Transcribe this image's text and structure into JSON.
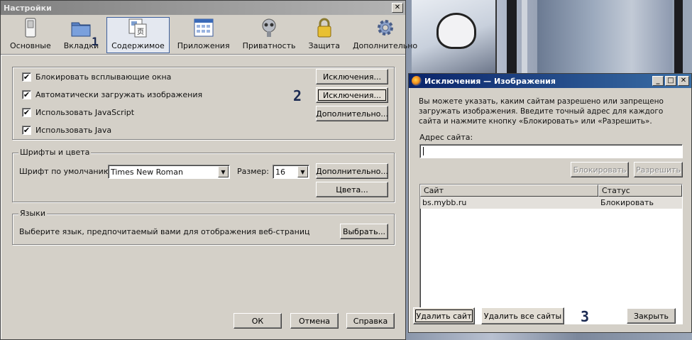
{
  "settings": {
    "title": "Настройки",
    "close": "✕",
    "tabs": [
      {
        "label": "Основные",
        "icon": "switch-icon"
      },
      {
        "label": "Вкладки",
        "icon": "folder-tabs-icon"
      },
      {
        "label": "Содержимое",
        "icon": "content-icon"
      },
      {
        "label": "Приложения",
        "icon": "applications-icon"
      },
      {
        "label": "Приватность",
        "icon": "privacy-mask-icon"
      },
      {
        "label": "Защита",
        "icon": "lock-icon"
      },
      {
        "label": "Дополнительно",
        "icon": "gear-icon"
      }
    ],
    "selected_tab": "Содержимое",
    "callout_1": "1",
    "content": {
      "checkboxes": [
        {
          "label": "Блокировать всплывающие окна",
          "checked": true
        },
        {
          "label": "Автоматически загружать изображения",
          "checked": true
        },
        {
          "label": "Использовать JavaScript",
          "checked": true
        },
        {
          "label": "Использовать Java",
          "checked": true
        }
      ],
      "btn_exceptions_popups": "Исключения...",
      "btn_exceptions_images": "Исключения...",
      "btn_js_advanced": "Дополнительно...",
      "callout_2": "2"
    },
    "fonts": {
      "group_title": "Шрифты и цвета",
      "default_font_label": "Шрифт по умолчанию:",
      "default_font_value": "Times New Roman",
      "size_label": "Размер:",
      "size_value": "16",
      "btn_advanced": "Дополнительно...",
      "btn_colors": "Цвета..."
    },
    "languages": {
      "group_title": "Языки",
      "description": "Выберите язык, предпочитаемый вами для отображения веб-страниц",
      "btn_choose": "Выбрать..."
    },
    "buttons": {
      "ok": "ОК",
      "cancel": "Отмена",
      "help": "Справка"
    }
  },
  "exceptions": {
    "title": "Исключения — Изображения",
    "window_controls": {
      "minimize": "_",
      "maximize": "□",
      "close": "✕"
    },
    "description": "Вы можете указать, каким сайтам разрешено или запрещено загружать изображения. Введите точный адрес для каждого сайта и нажмите кнопку «Блокировать» или «Разрешить».",
    "address_label": "Адрес сайта:",
    "address_value": "",
    "btn_block": "Блокировать",
    "btn_allow": "Разрешить",
    "columns": [
      "Сайт",
      "Статус"
    ],
    "rows": [
      {
        "site": "bs.mybb.ru",
        "status": "Блокировать"
      }
    ],
    "btn_remove_site": "Удалить сайт",
    "btn_remove_all": "Удалить все сайты",
    "btn_close": "Закрыть",
    "callout_3": "3"
  },
  "colors": {
    "active_title_start": "#0a246a",
    "active_title_end": "#3a6ea5",
    "inactive_title_start": "#808080",
    "window_face": "#d4d0c8",
    "selected_tab_border": "#3d5f9c",
    "callout": "#1b2a52"
  }
}
